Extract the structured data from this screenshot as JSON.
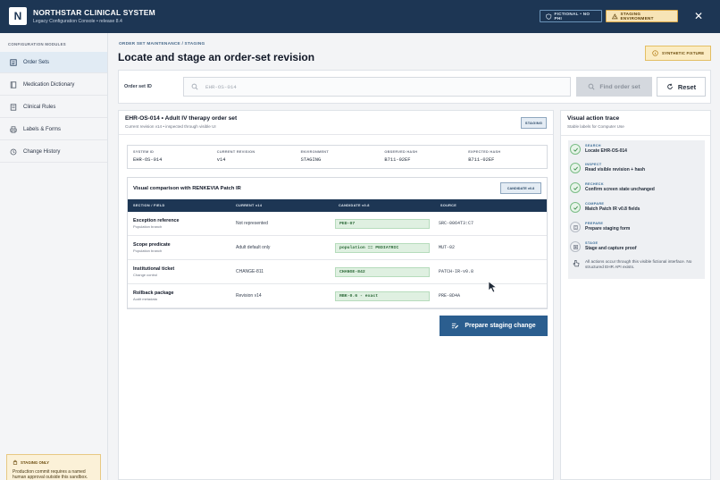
{
  "header": {
    "logo_letter": "N",
    "title": "NORTHSTAR CLINICAL SYSTEM",
    "subtitle": "Legacy Configuration Console • release 8.4",
    "badge_fictional": "FICTIONAL • NO PHI",
    "badge_staging": "STAGING ENVIRONMENT",
    "close_label": "✕"
  },
  "sidebar": {
    "heading": "CONFIGURATION MODULES",
    "items": [
      {
        "label": "Order Sets",
        "icon": "list-icon",
        "active": true
      },
      {
        "label": "Medication Dictionary",
        "icon": "book-icon",
        "active": false
      },
      {
        "label": "Clinical Rules",
        "icon": "rules-icon",
        "active": false
      },
      {
        "label": "Labels & Forms",
        "icon": "printer-icon",
        "active": false
      },
      {
        "label": "Change History",
        "icon": "history-icon",
        "active": false
      }
    ],
    "note": {
      "title": "STAGING ONLY",
      "body": "Production commit requires a named human approval outside this sandbox."
    }
  },
  "main": {
    "breadcrumb": "ORDER SET MAINTENANCE / STAGING",
    "title": "Locate and stage an order-set revision",
    "synthetic_badge": "SYNTHETIC FIXTURE",
    "search": {
      "label": "Order set ID",
      "placeholder": "EHR-OS-014",
      "value": "",
      "find_label": "Find order set",
      "reset_label": "Reset"
    },
    "order": {
      "title": "EHR-OS-014 • Adult IV therapy order set",
      "subtitle": "Current revision v14 • inspected through visible UI",
      "tag": "STAGING",
      "info": [
        {
          "key": "SYSTEM ID",
          "value": "EHR-OS-014"
        },
        {
          "key": "CURRENT REVISION",
          "value": "v14"
        },
        {
          "key": "ENVIRONMENT",
          "value": "STAGING"
        },
        {
          "key": "OBSERVED HASH",
          "value": "B711-02EF"
        },
        {
          "key": "EXPECTED HASH",
          "value": "B711-02EF"
        }
      ],
      "comparison": {
        "title": "Visual comparison with RENKEVIA Patch IR",
        "tag": "CANDIDATE v0.8",
        "columns": [
          "SECTION / FIELD",
          "CURRENT v14",
          "CANDIDATE v0.8",
          "SOURCE"
        ],
        "rows": [
          {
            "field": "Exception reference",
            "sub": "Population branch",
            "current": "Not represented",
            "candidate": "PED-07",
            "source": "SRC-0064T3:C7"
          },
          {
            "field": "Scope predicate",
            "sub": "Population branch",
            "current": "Adult default only",
            "candidate": "population == PEDIATRIC",
            "source": "MUT-02"
          },
          {
            "field": "Institutional ticket",
            "sub": "Change control",
            "current": "CHANGE-811",
            "candidate": "CHANGE-842",
            "source": "PATCH-IR-v0.8"
          },
          {
            "field": "Rollback package",
            "sub": "Audit metadata",
            "current": "Revision v14",
            "candidate": "RBK-0.6 - exact",
            "source": "PRE-8D4A"
          }
        ]
      },
      "prepare_label": "Prepare staging change"
    }
  },
  "trace": {
    "title": "Visual action trace",
    "subtitle": "Stable labels for Computer Use",
    "steps": [
      {
        "key": "SEARCH",
        "value": "Locate EHR-OS-014",
        "done": true
      },
      {
        "key": "INSPECT",
        "value": "Read visible revision + hash",
        "done": true
      },
      {
        "key": "RECHECK",
        "value": "Confirm screen state unchanged",
        "done": true
      },
      {
        "key": "COMPARE",
        "value": "Match Patch IR v0.8 fields",
        "done": true
      },
      {
        "key": "PREPARE",
        "value": "Prepare staging form",
        "done": false
      },
      {
        "key": "STAGE",
        "value": "Stage and capture proof",
        "done": false
      }
    ],
    "footer": "All actions occur through this visible fictional interface. No structured EHR API exists."
  },
  "colors": {
    "header_bg": "#1d3654",
    "accent": "#2b5e8f",
    "success": "#2e6b3a",
    "warning_bg": "#fbecc3"
  }
}
